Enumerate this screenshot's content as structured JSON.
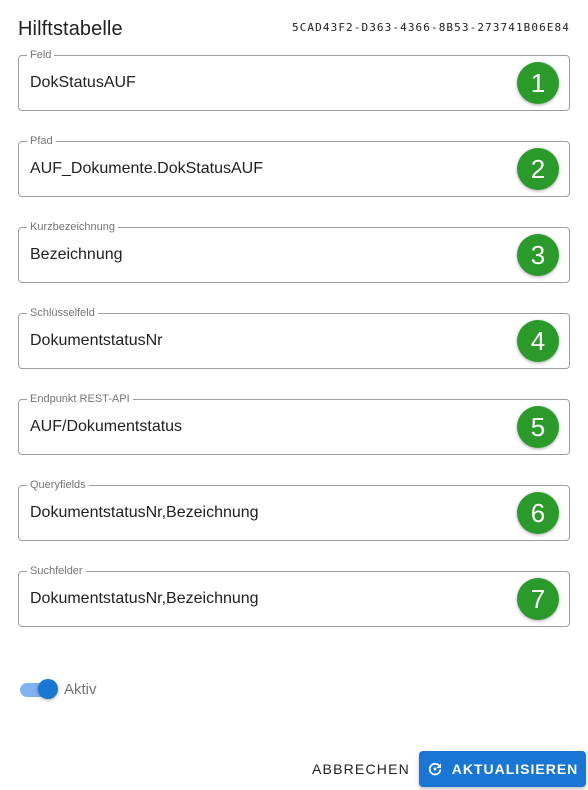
{
  "dialog": {
    "title": "Hilftstabelle",
    "id": "5CAD43F2-D363-4366-8B53-273741B06E84"
  },
  "fields": [
    {
      "label": "Feld",
      "value": "DokStatusAUF",
      "badge": "1"
    },
    {
      "label": "Pfad",
      "value": "AUF_Dokumente.DokStatusAUF",
      "badge": "2"
    },
    {
      "label": "Kurzbezeichnung",
      "value": "Bezeichnung",
      "badge": "3"
    },
    {
      "label": "Schlüsselfeld",
      "value": "DokumentstatusNr",
      "badge": "4"
    },
    {
      "label": "Endpunkt REST-API",
      "value": "AUF/Dokumentstatus",
      "badge": "5"
    },
    {
      "label": "Queryfields",
      "value": "DokumentstatusNr,Bezeichnung",
      "badge": "6"
    },
    {
      "label": "Suchfelder",
      "value": "DokumentstatusNr,Bezeichnung",
      "badge": "7"
    }
  ],
  "toggle": {
    "label": "Aktiv",
    "checked": true
  },
  "actions": {
    "cancel_label": "ABBRECHEN",
    "update_label": "AKTUALISIEREN",
    "update_icon": "refresh-icon"
  },
  "colors": {
    "primary": "#1976d2",
    "badge": "#2b9a2b",
    "toggle_track": "#7fb2ee"
  }
}
